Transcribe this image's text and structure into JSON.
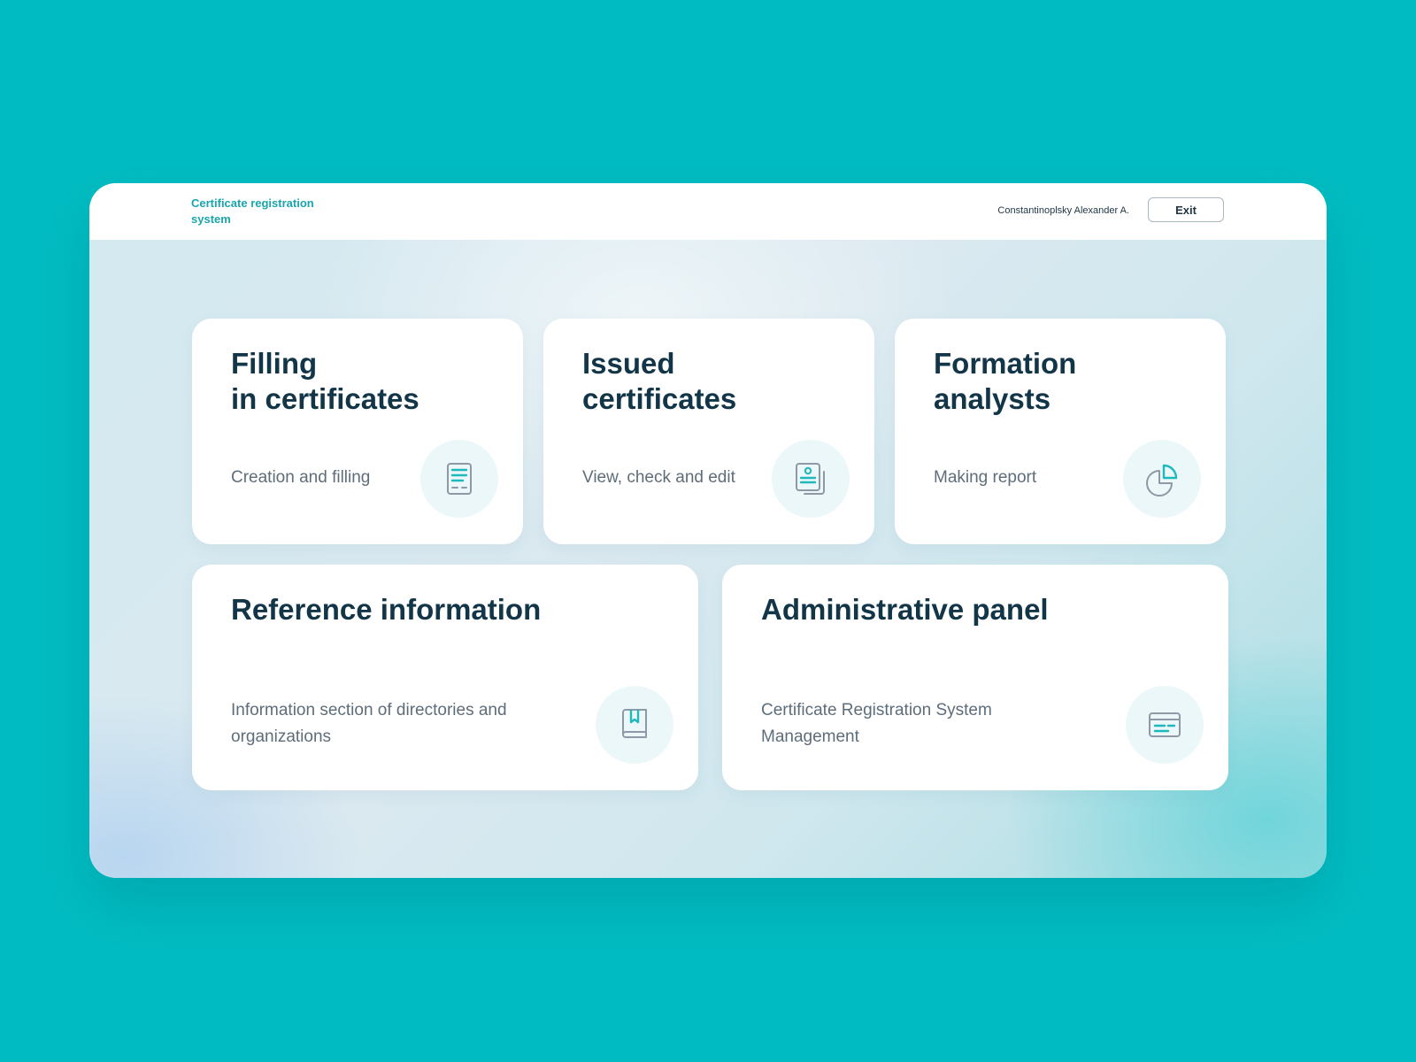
{
  "header": {
    "brand": "Certificate registration system",
    "user_name": "Constantinoplsky Alexander A.",
    "exit_label": "Exit"
  },
  "cards": [
    {
      "id": "filling",
      "title": "Filling\nin certificates",
      "description": "Creation and filling",
      "icon": "document-icon"
    },
    {
      "id": "issued",
      "title": "Issued\ncertificates",
      "description": "View, check and edit",
      "icon": "certificate-stack-icon"
    },
    {
      "id": "analysts",
      "title": "Formation\nanalysts",
      "description": "Making report",
      "icon": "pie-chart-icon"
    },
    {
      "id": "reference",
      "title": "Reference information",
      "description": "Information section of directories and organizations",
      "icon": "bookmark-book-icon"
    },
    {
      "id": "admin",
      "title": "Administrative panel",
      "description": "Certificate Registration System Management",
      "icon": "admin-card-icon"
    }
  ],
  "colors": {
    "page_background": "#00bcc2",
    "brand": "#1aa5ad",
    "title": "#123547",
    "icon_accent": "#1fb9bd",
    "icon_stroke": "#8d99a6"
  }
}
